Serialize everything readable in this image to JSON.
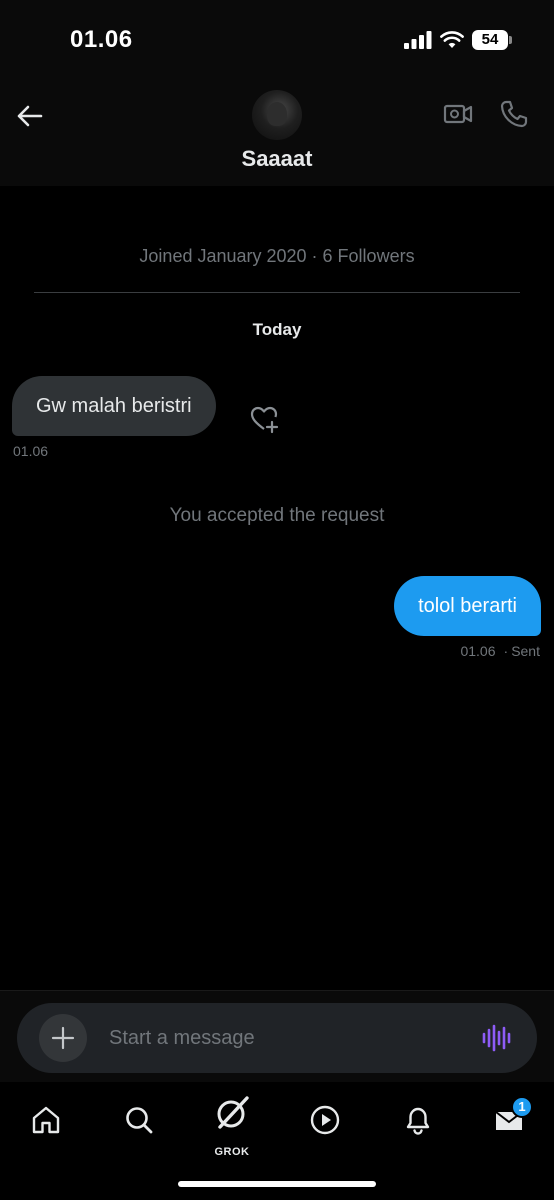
{
  "status_bar": {
    "time": "01.06",
    "battery": "54"
  },
  "header": {
    "contact_name": "Saaaat",
    "back_icon": "arrow-left-icon",
    "video_icon": "video-camera-icon",
    "call_icon": "phone-icon"
  },
  "conversation": {
    "profile_meta": "Joined January 2020 · 6 Followers",
    "day_label": "Today",
    "incoming": {
      "text": "Gw malah beristri",
      "time": "01.06"
    },
    "system_note": "You accepted the request",
    "outgoing": {
      "text": "tolol berarti",
      "time": "01.06",
      "status": "Sent"
    }
  },
  "composer": {
    "placeholder": "Start a message"
  },
  "tab_bar": {
    "grok_label": "GROK",
    "messages_badge": "1"
  },
  "colors": {
    "accent": "#1d9bf0",
    "voice": "#8e5cf7",
    "background": "#000000",
    "bubble_incoming": "#2f3336"
  }
}
